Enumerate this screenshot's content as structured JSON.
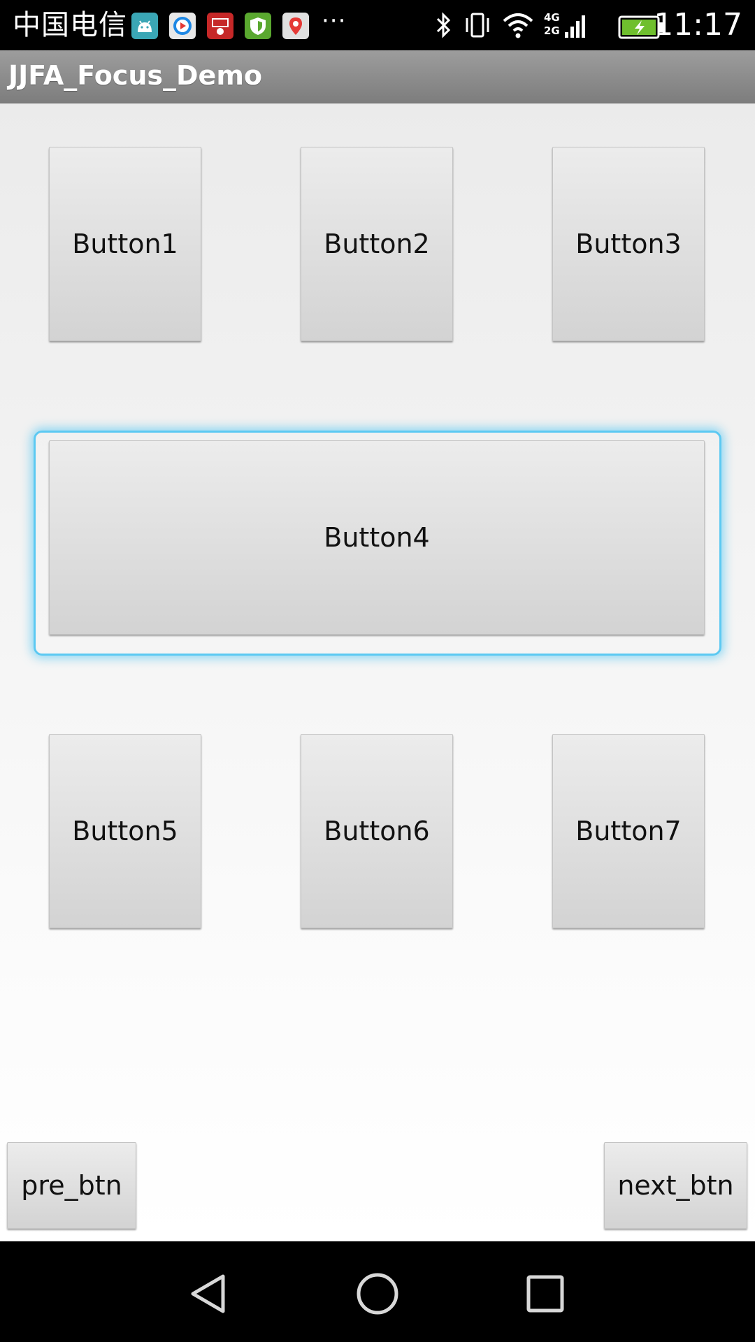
{
  "status_bar": {
    "carrier": "中国电信",
    "time": "11:17",
    "more": "···",
    "network": "4G 2G",
    "icons": [
      "android-icon",
      "video-app-icon",
      "netease-app-icon",
      "shield-app-icon",
      "map-app-icon",
      "bluetooth-icon",
      "vibrate-icon",
      "wifi-icon",
      "signal-icon",
      "battery-charging-icon"
    ]
  },
  "action_bar": {
    "title": "JJFA_Focus_Demo"
  },
  "buttons": {
    "b1": "Button1",
    "b2": "Button2",
    "b3": "Button3",
    "b4": "Button4",
    "b5": "Button5",
    "b6": "Button6",
    "b7": "Button7",
    "pre": "pre_btn",
    "next": "next_btn"
  },
  "focus_color": "#5cc9f2",
  "nav_bar": {
    "icons": [
      "back-icon",
      "home-icon",
      "recents-icon"
    ]
  }
}
